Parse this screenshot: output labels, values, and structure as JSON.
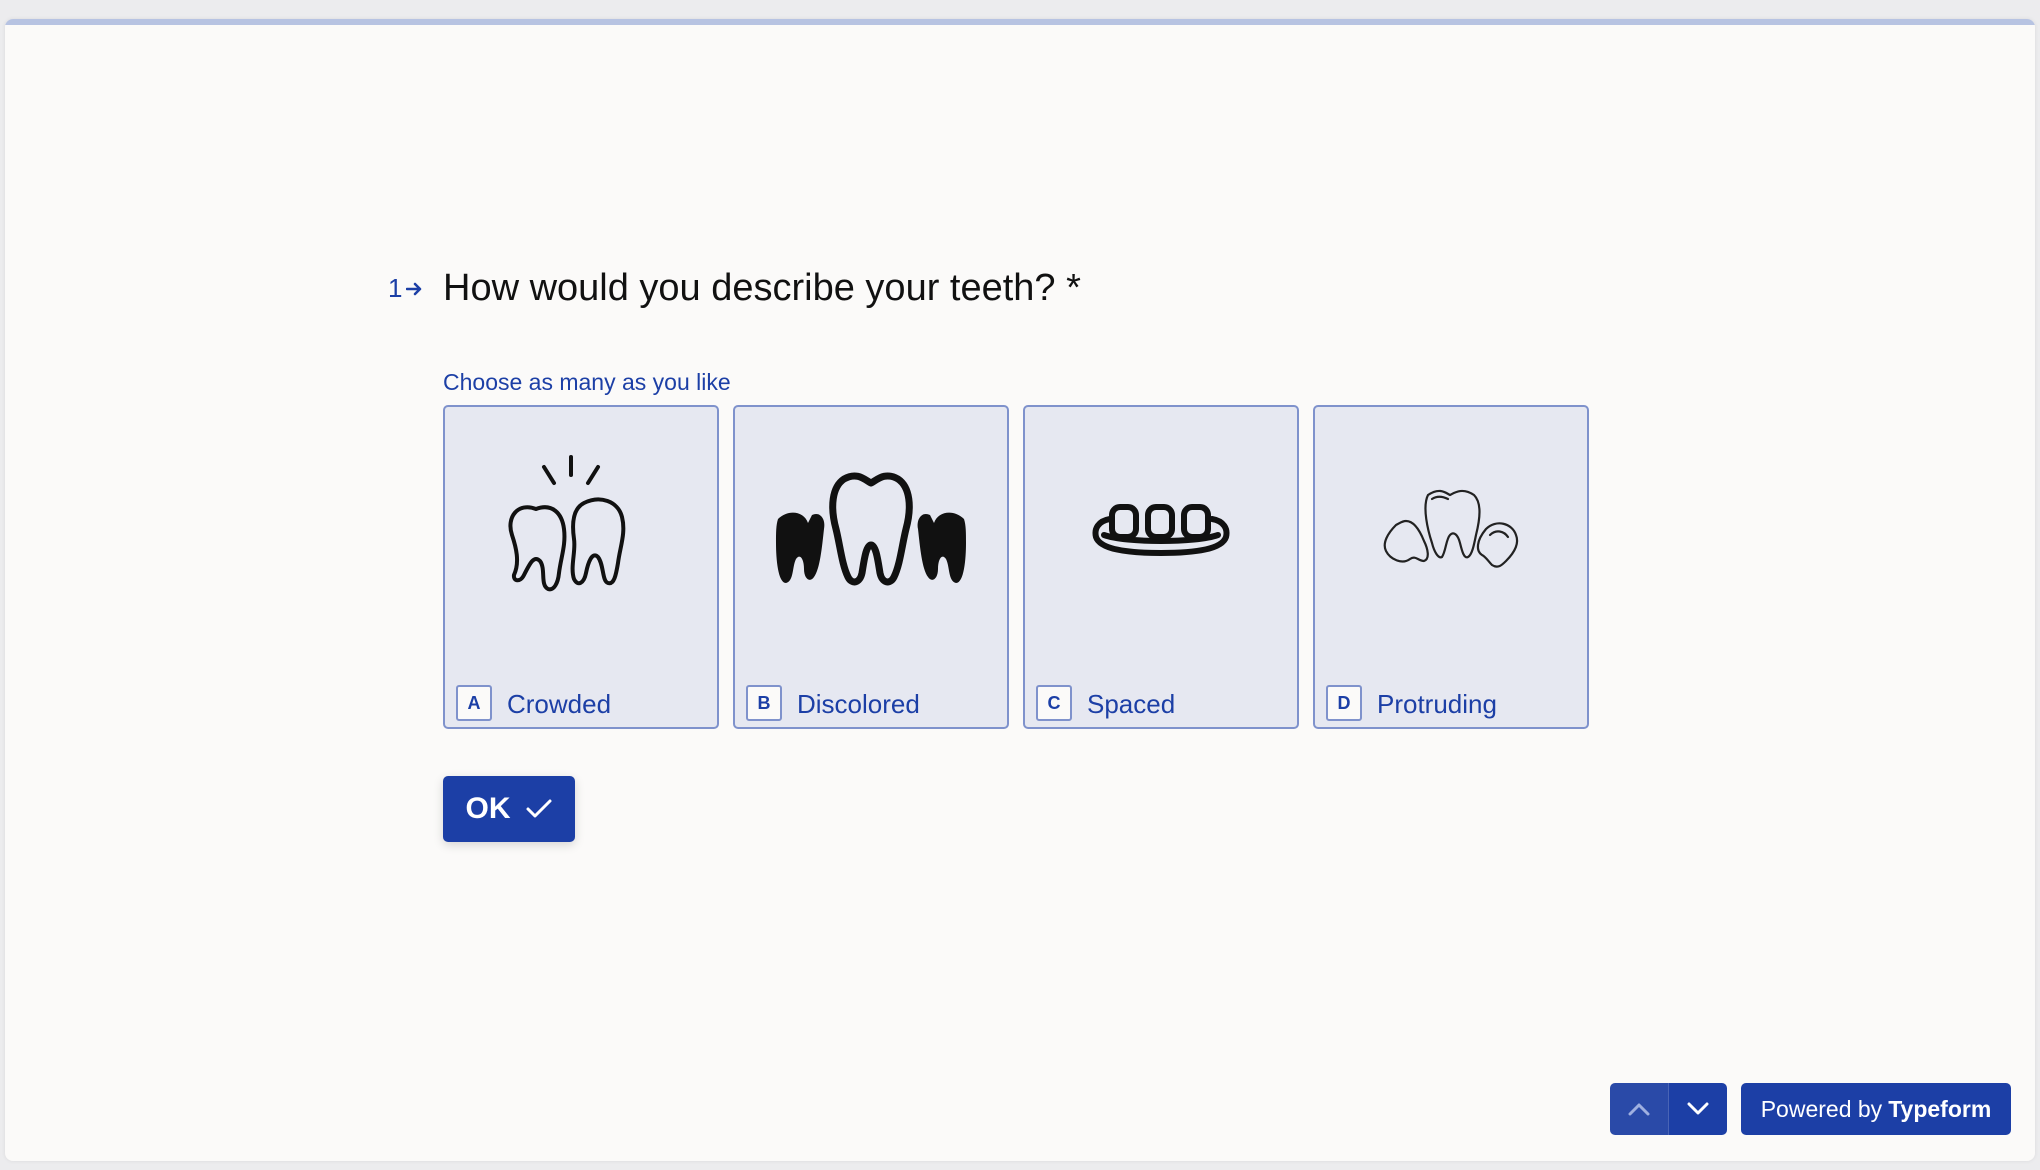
{
  "progress": {
    "fraction": 0.0
  },
  "question": {
    "number": "1",
    "title": "How would you describe your teeth? *",
    "hint": "Choose as many as you like"
  },
  "choices": [
    {
      "key": "A",
      "label": "Crowded",
      "icon": "crowded-teeth-icon"
    },
    {
      "key": "B",
      "label": "Discolored",
      "icon": "discolored-teeth-icon"
    },
    {
      "key": "C",
      "label": "Spaced",
      "icon": "spaced-teeth-icon"
    },
    {
      "key": "D",
      "label": "Protruding",
      "icon": "protruding-teeth-icon"
    }
  ],
  "ok_button": {
    "label": "OK"
  },
  "footer": {
    "powered_prefix": "Powered by",
    "powered_brand": "Typeform"
  },
  "colors": {
    "accent": "#1c3fa6",
    "choice_bg": "#e6e8f1",
    "choice_border": "#7f92cc",
    "page_bg": "#fbfaf9"
  }
}
